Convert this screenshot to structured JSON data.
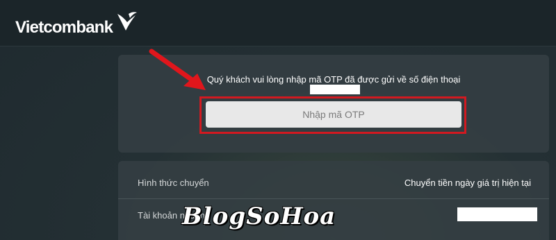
{
  "header": {
    "brand_name": "Vietcombank",
    "logo_icon": "vietcombank-v-logo"
  },
  "otp_panel": {
    "message": "Quý khách vui lòng nhập mã OTP đã được gửi về số điện thoại",
    "otp_input_placeholder": "Nhập mã OTP",
    "otp_input_value": "",
    "highlight_color": "#d21920"
  },
  "info_panel": {
    "rows": [
      {
        "label": "Hình thức chuyển",
        "value": "Chuyển tiền ngày giá trị hiện tại"
      },
      {
        "label": "Tài khoản nguồn",
        "value": ""
      }
    ]
  },
  "watermark": {
    "text": "BlogSoHoa"
  },
  "colors": {
    "accent_red": "#e0161c",
    "header_bg": "#1b2529",
    "panel_bg": "#343e42"
  }
}
